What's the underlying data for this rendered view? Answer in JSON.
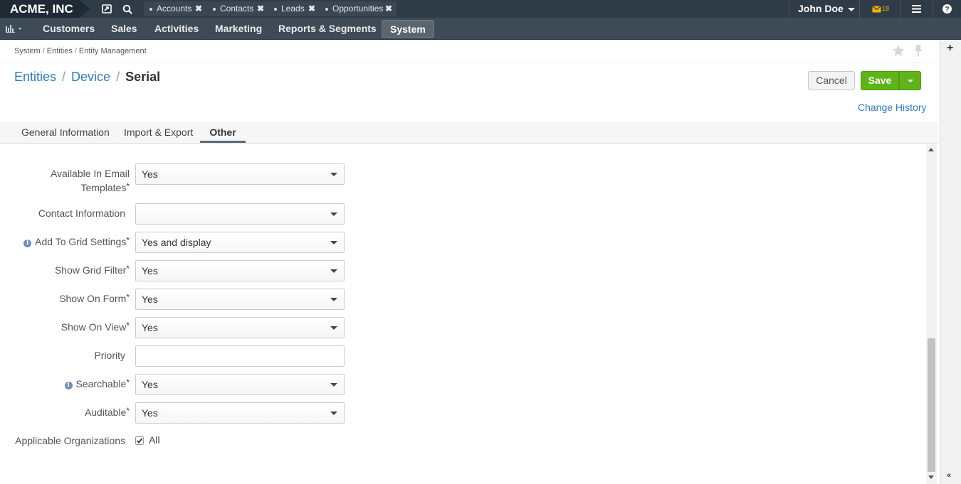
{
  "topbar": {
    "brand": "ACME, INC",
    "pinned_tabs": [
      {
        "label": "Accounts"
      },
      {
        "label": "Contacts"
      },
      {
        "label": "Leads"
      },
      {
        "label": "Opportunities"
      }
    ],
    "user_name": "John Doe",
    "mail_count": "18"
  },
  "nav": {
    "items": [
      "Customers",
      "Sales",
      "Activities",
      "Marketing",
      "Reports & Segments",
      "System"
    ],
    "active": "System"
  },
  "breadcrumb": [
    "System",
    "Entities",
    "Entity Management"
  ],
  "title": {
    "part1": "Entities",
    "part2": "Device",
    "current": "Serial"
  },
  "actions": {
    "cancel": "Cancel",
    "save": "Save",
    "change_history": "Change History"
  },
  "tabs": [
    "General Information",
    "Import & Export",
    "Other"
  ],
  "active_tab": "Other",
  "form": {
    "available_in_email_templates": {
      "label_line1": "Available In Email",
      "label_line2": "Templates",
      "value": "Yes"
    },
    "contact_information": {
      "label": "Contact Information",
      "value": ""
    },
    "add_to_grid_settings": {
      "label": "Add To Grid Settings",
      "value": "Yes and display"
    },
    "show_grid_filter": {
      "label": "Show Grid Filter",
      "value": "Yes"
    },
    "show_on_form": {
      "label": "Show On Form",
      "value": "Yes"
    },
    "show_on_view": {
      "label": "Show On View",
      "value": "Yes"
    },
    "priority": {
      "label": "Priority",
      "value": ""
    },
    "searchable": {
      "label": "Searchable",
      "value": "Yes"
    },
    "auditable": {
      "label": "Auditable",
      "value": "Yes"
    },
    "applicable_organizations": {
      "label": "Applicable Organizations",
      "option": "All",
      "checked": true
    }
  },
  "required_mark": "*",
  "colors": {
    "topbar": "#2f3b47",
    "navbar": "#3e4a55",
    "save": "#5fb41a",
    "link": "#2e7cc0"
  }
}
